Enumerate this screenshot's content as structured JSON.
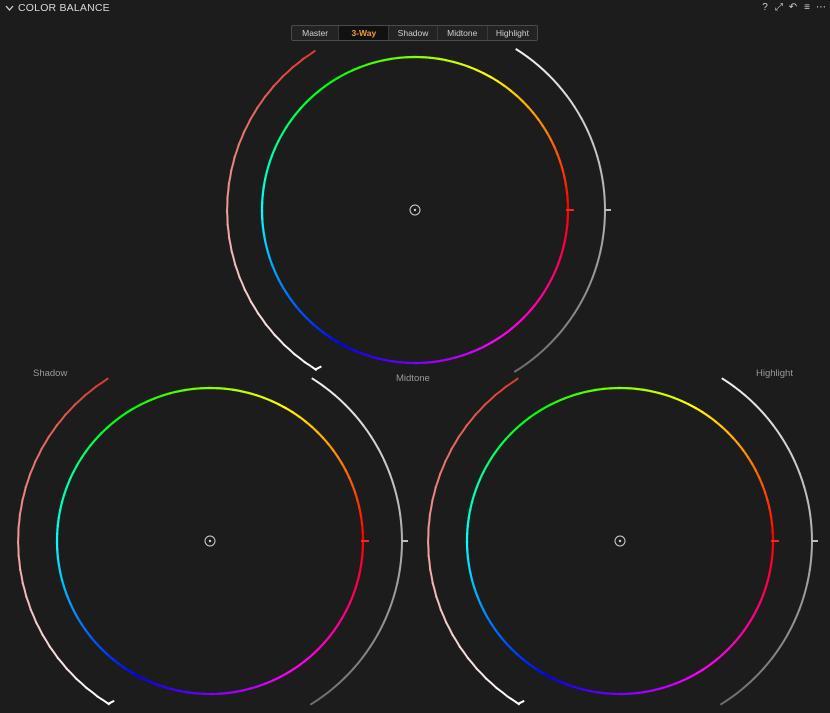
{
  "panel": {
    "title": "COLOR BALANCE",
    "collapse_icon": "chevron-down-icon",
    "tools": [
      {
        "name": "help-icon",
        "glyph": "?"
      },
      {
        "name": "pop-out-icon",
        "glyph": "⤢"
      },
      {
        "name": "reset-icon",
        "glyph": "↶"
      },
      {
        "name": "presets-icon",
        "glyph": "≡"
      },
      {
        "name": "more-icon",
        "glyph": "⋯"
      }
    ]
  },
  "tabs": [
    {
      "id": "master",
      "label": "Master",
      "active": false
    },
    {
      "id": "3way",
      "label": "3-Way",
      "active": true
    },
    {
      "id": "shadow",
      "label": "Shadow",
      "active": false
    },
    {
      "id": "midtone",
      "label": "Midtone",
      "active": false
    },
    {
      "id": "highlight",
      "label": "Highlight",
      "active": false
    }
  ],
  "wheels": [
    {
      "id": "midtone",
      "label": "Midtone",
      "show_label": false,
      "color_offset": [
        0,
        0
      ],
      "saturation": 0,
      "brightness": 0
    },
    {
      "id": "shadow",
      "label": "Shadow",
      "show_label": true,
      "color_offset": [
        0,
        0
      ],
      "saturation": 0,
      "brightness": 0
    },
    {
      "id": "midtone-label",
      "label": "Midtone",
      "show_label": true
    },
    {
      "id": "highlight",
      "label": "Highlight",
      "show_label": true,
      "color_offset": [
        0,
        0
      ],
      "saturation": 0,
      "brightness": 0
    }
  ],
  "labels": {
    "shadow": "Shadow",
    "midtone": "Midtone",
    "highlight": "Highlight"
  },
  "colors": {
    "background": "#1c1c1c",
    "active_tab": "#f29a2e",
    "marker": "#ff2020"
  }
}
